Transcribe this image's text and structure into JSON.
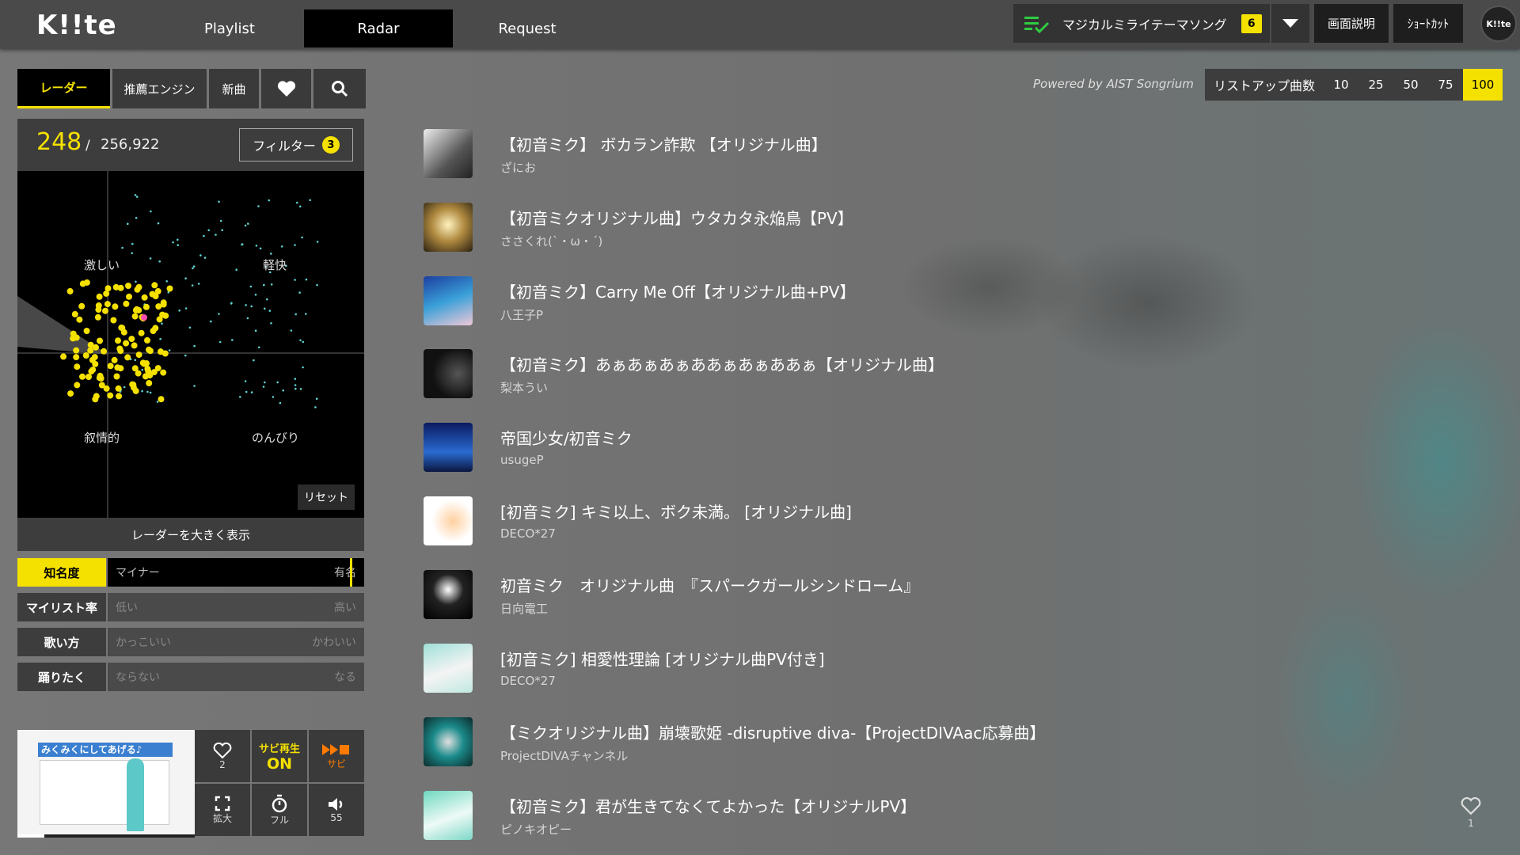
{
  "app": {
    "logo": "K!!te"
  },
  "nav": {
    "tabs": [
      {
        "label": "Playlist"
      },
      {
        "label": "Radar"
      },
      {
        "label": "Request"
      }
    ]
  },
  "header": {
    "theme_song": "マジカルミライテーマソング",
    "theme_count": "6",
    "explain_button": "画面説明",
    "shortcut_button": "ｼｮｰﾄｶｯﾄ",
    "avatar_text": "K!!te"
  },
  "left_tabs": {
    "radar": "レーダー",
    "engine": "推薦エンジン",
    "new": "新曲"
  },
  "counter": {
    "shown": "248",
    "slash": "/",
    "total": "256,922",
    "filter_label": "フィルター",
    "filter_count": "3"
  },
  "radar": {
    "labels": {
      "top_left": "激しい",
      "top_right": "軽快",
      "bottom_left": "叙情的",
      "bottom_right": "のんびり"
    },
    "reset": "リセット",
    "expand": "レーダーを大きく表示",
    "colors": {
      "highlight": "#f5e100",
      "other": "#5fd0d0"
    }
  },
  "sliders": [
    {
      "label": "知名度",
      "low": "マイナー",
      "high": "有名",
      "active": true,
      "value": 0.95
    },
    {
      "label": "マイリスト率",
      "low": "低い",
      "high": "高い",
      "active": false
    },
    {
      "label": "歌い方",
      "low": "かっこいい",
      "high": "かわいい",
      "active": false
    },
    {
      "label": "踊りたく",
      "low": "ならない",
      "high": "なる",
      "active": false
    }
  ],
  "player": {
    "thumb_text": "みくみくにしてあげる♪",
    "fav_count": "2",
    "sabi_label": "サビ再生",
    "sabi_state": "ON",
    "sabi_short": "サビ",
    "expand_label": "拡大",
    "full_label": "フル",
    "volume": "55"
  },
  "list": {
    "powered": "Powered by AIST Songrium",
    "count_label": "リストアップ曲数",
    "count_options": [
      "10",
      "25",
      "50",
      "75",
      "100"
    ],
    "selected": "100",
    "fav_count": "1",
    "songs": [
      {
        "title": "【初音ミク】 ボカラン詐欺 【オリジナル曲】",
        "artist": "ざにお"
      },
      {
        "title": "【初音ミクオリジナル曲】ウタカタ永焔鳥【PV】",
        "artist": "ささくれ(`・ω・´)"
      },
      {
        "title": "【初音ミク】Carry Me Off【オリジナル曲+PV】",
        "artist": "八王子P"
      },
      {
        "title": "【初音ミク】あぁあぁあぁああぁあぁああぁ【オリジナル曲】",
        "artist": "梨本うい"
      },
      {
        "title": "帝国少女/初音ミク",
        "artist": "usugeP"
      },
      {
        "title": "[初音ミク] キミ以上、ボク未満。 [オリジナル曲]",
        "artist": "DECO*27"
      },
      {
        "title": "初音ミク　オリジナル曲　『スパークガールシンドローム』",
        "artist": "日向電工"
      },
      {
        "title": "[初音ミク] 相愛性理論 [オリジナル曲PV付き]",
        "artist": "DECO*27"
      },
      {
        "title": "【ミクオリジナル曲】崩壊歌姫 -disruptive diva-【ProjectDIVAac応募曲】",
        "artist": "ProjectDIVAチャンネル"
      },
      {
        "title": "【初音ミク】君が生きてなくてよかった【オリジナルPV】",
        "artist": "ピノキオピー"
      }
    ]
  }
}
